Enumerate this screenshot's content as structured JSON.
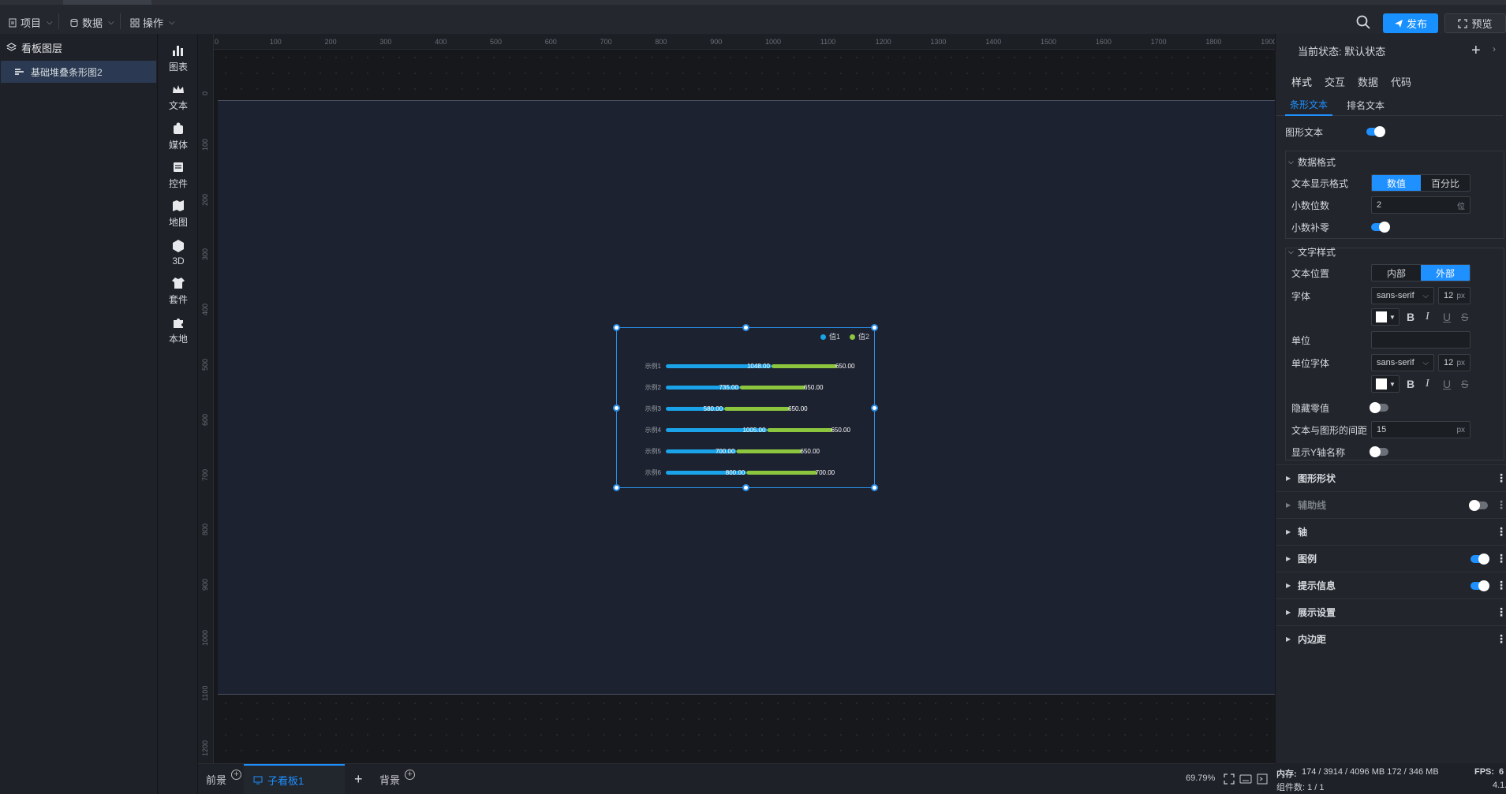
{
  "topbar": {
    "menus": [
      {
        "label": "项目"
      },
      {
        "label": "数据"
      },
      {
        "label": "操作"
      }
    ],
    "publish_label": "发布",
    "preview_label": "预览"
  },
  "layers": {
    "title": "看板图层",
    "items": [
      {
        "label": "基础堆叠条形图2"
      }
    ]
  },
  "tools": [
    "图表",
    "文本",
    "媒体",
    "控件",
    "地图",
    "3D",
    "套件",
    "本地"
  ],
  "ruler": {
    "top": [
      "0",
      "100",
      "200",
      "300",
      "400",
      "500",
      "600",
      "700",
      "800",
      "900",
      "1000",
      "1100",
      "1200",
      "1300",
      "1400",
      "1500",
      "1600",
      "1700",
      "1800",
      "1900"
    ],
    "left": [
      "0",
      "100",
      "200",
      "300",
      "400",
      "500",
      "600",
      "700",
      "800",
      "900",
      "1000",
      "1100",
      "1200"
    ]
  },
  "chart_data": {
    "type": "bar",
    "orientation": "horizontal",
    "stacked": true,
    "categories": [
      "示例1",
      "示例2",
      "示例3",
      "示例4",
      "示例5",
      "示例6"
    ],
    "series": [
      {
        "name": "值1",
        "color": "#1aa3e8",
        "values": [
          1048.0,
          735.0,
          580.0,
          1005.0,
          700.0,
          800.0
        ]
      },
      {
        "name": "值2",
        "color": "#8cc63f",
        "values": [
          650.0,
          650.0,
          650.0,
          650.0,
          650.0,
          700.0
        ]
      }
    ],
    "labels1": [
      "1048.00",
      "735.00",
      "580.00",
      "1005.00",
      "700.00",
      "800.00"
    ],
    "labels2": [
      "650.00",
      "650.00",
      "650.00",
      "650.00",
      "650.00",
      "700.00"
    ],
    "legend_position": "top-right"
  },
  "bottombar": {
    "tabs": [
      {
        "label": "前景"
      },
      {
        "label": "子看板1"
      },
      {
        "label": "背景"
      }
    ],
    "zoom": "69.79%"
  },
  "panel": {
    "state_label": "当前状态: 默认状态",
    "tabs": [
      "样式",
      "交互",
      "数据",
      "代码"
    ],
    "subtabs": [
      "条形文本",
      "排名文本"
    ],
    "graphic_text_label": "图形文本",
    "data_format": {
      "title": "数据格式",
      "display_format_label": "文本显示格式",
      "display_options": [
        "数值",
        "百分比"
      ],
      "decimals_label": "小数位数",
      "decimals_value": "2",
      "decimals_suffix": "位",
      "zero_pad_label": "小数补零"
    },
    "text_style": {
      "title": "文字样式",
      "position_label": "文本位置",
      "position_options": [
        "内部",
        "外部"
      ],
      "font_label": "字体",
      "font_value": "sans-serif",
      "font_size": "12",
      "px": "px",
      "unit_label": "单位",
      "unit_value": "",
      "unit_font_label": "单位字体",
      "unit_font_value": "sans-serif",
      "unit_font_size": "12",
      "hide_zero_label": "隐藏零值",
      "gap_label": "文本与图形的间距",
      "gap_value": "15",
      "show_y_label": "显示Y轴名称"
    },
    "sections": [
      "图形形状",
      "辅助线",
      "轴",
      "图例",
      "提示信息",
      "展示设置",
      "内边距"
    ]
  },
  "status": {
    "memory": "内存:",
    "memory_value": "174 / 3914 / 4096 MB  172 / 346 MB",
    "fps": "FPS:",
    "fps_value": "6",
    "components": "组件数: 1 / 1",
    "version": "4.1."
  }
}
